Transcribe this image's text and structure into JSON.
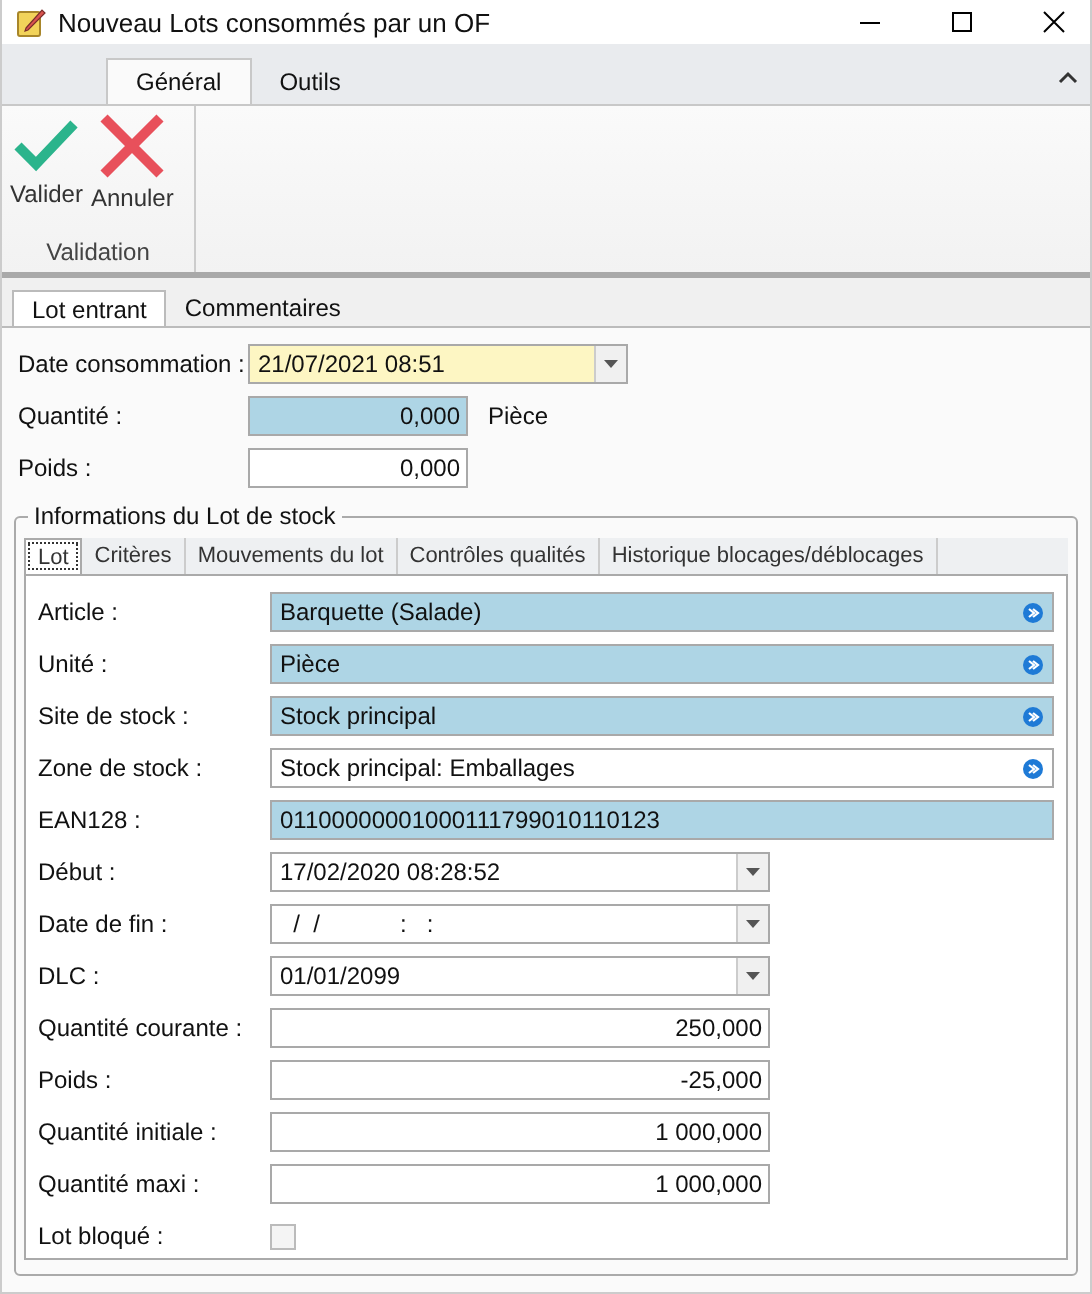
{
  "window": {
    "title": "Nouveau Lots consommés par un OF"
  },
  "ribbon": {
    "tabs": [
      {
        "label": "Général",
        "selected": true
      },
      {
        "label": "Outils",
        "selected": false
      }
    ],
    "groups": [
      {
        "label": "Validation",
        "buttons": [
          {
            "label": "Valider",
            "kind": "check"
          },
          {
            "label": "Annuler",
            "kind": "cross"
          }
        ]
      }
    ]
  },
  "form_tabs": [
    {
      "label": "Lot entrant",
      "selected": true
    },
    {
      "label": "Commentaires",
      "selected": false
    }
  ],
  "form_fields": [
    {
      "label": "Date consommation :",
      "kind": "date",
      "value": "21/07/2021 08:51",
      "focused": true,
      "required": false
    },
    {
      "label": "Quantité :",
      "kind": "number",
      "value": "0,000",
      "unit": "Pièce",
      "focused": false,
      "required": true
    },
    {
      "label": "Poids :",
      "kind": "number",
      "value": "0,000",
      "focused": false,
      "required": false
    }
  ],
  "lot_group": {
    "title": "Informations du Lot de stock",
    "tabs": [
      {
        "label": "Lot",
        "selected": true
      },
      {
        "label": "Critères",
        "selected": false
      },
      {
        "label": "Mouvements du lot",
        "selected": false
      },
      {
        "label": "Contrôles qualités",
        "selected": false
      },
      {
        "label": "Historique blocages/déblocages",
        "selected": false
      }
    ],
    "fields": [
      {
        "label": "Article :",
        "kind": "lookup",
        "value": "Barquette (Salade)",
        "required": true
      },
      {
        "label": "Unité :",
        "kind": "lookup",
        "value": "Pièce",
        "required": true
      },
      {
        "label": "Site de stock :",
        "kind": "lookup",
        "value": "Stock principal",
        "required": true
      },
      {
        "label": "Zone de stock :",
        "kind": "lookup",
        "value": "Stock principal: Emballages",
        "required": false
      },
      {
        "label": "EAN128 :",
        "kind": "text",
        "value": "01100000001000111799010110123",
        "required": true
      },
      {
        "label": "Début :",
        "kind": "date",
        "value": "17/02/2020 08:28:52",
        "required": false
      },
      {
        "label": "Date de fin :",
        "kind": "date",
        "value": "  /  /            :   :",
        "required": false
      },
      {
        "label": "DLC :",
        "kind": "date",
        "value": "01/01/2099",
        "required": false
      },
      {
        "label": "Quantité courante :",
        "kind": "number",
        "value": "250,000",
        "required": false
      },
      {
        "label": "Poids :",
        "kind": "number",
        "value": "-25,000",
        "required": false
      },
      {
        "label": "Quantité initiale :",
        "kind": "number",
        "value": "1 000,000",
        "required": false
      },
      {
        "label": "Quantité maxi :",
        "kind": "number",
        "value": "1 000,000",
        "required": false
      },
      {
        "label": "Lot bloqué :",
        "kind": "checkbox",
        "checked": false
      }
    ]
  }
}
